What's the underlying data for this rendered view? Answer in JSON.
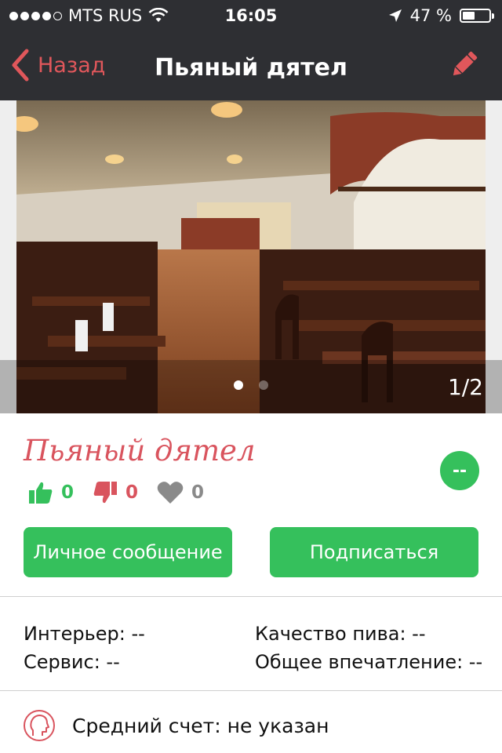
{
  "status_bar": {
    "carrier": "MTS RUS",
    "time": "16:05",
    "battery_text": "47 %",
    "battery_level": 0.47,
    "signal_bars_filled": 4,
    "signal_bars_total": 5,
    "icons": [
      "wifi-icon",
      "location-arrow-icon",
      "battery-icon"
    ]
  },
  "nav": {
    "back_label": "Назад",
    "title": "Пьяный дятел",
    "back_icon": "chevron-left-icon",
    "edit_icon": "pencil-icon"
  },
  "gallery": {
    "counter": "1/2",
    "current_index": 1,
    "total": 2
  },
  "venue": {
    "name": "Пьяный дятел",
    "rating": "--",
    "likes": "0",
    "dislikes": "0",
    "favorites": "0"
  },
  "actions": {
    "message_label": "Личное сообщение",
    "subscribe_label": "Подписаться"
  },
  "scores": {
    "interior": "Интерьер: --",
    "service": "Сервис: --",
    "beer_quality": "Качество пива: --",
    "overall": "Общее впечатление: --"
  },
  "average_bill": {
    "text": "Средний счет: не указан",
    "icon": "person-head-icon"
  },
  "colors": {
    "bar_bg": "#2e2f33",
    "accent_red": "#d9545e",
    "accent_green": "#35c05c",
    "neutral_gray": "#8a8a8a"
  }
}
